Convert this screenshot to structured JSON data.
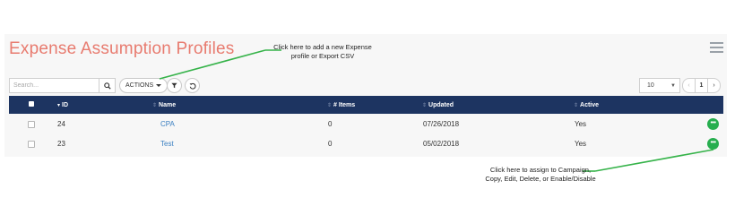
{
  "page": {
    "title": "Expense Assumption Profiles"
  },
  "toolbar": {
    "search_placeholder": "Search...",
    "actions_label": "ACTIONS",
    "page_size": "10",
    "current_page": "1"
  },
  "table": {
    "columns": [
      "ID",
      "Name",
      "# Items",
      "Updated",
      "Active"
    ],
    "rows": [
      {
        "id": "24",
        "name": "CPA",
        "items": "0",
        "updated": "07/26/2018",
        "active": "Yes"
      },
      {
        "id": "23",
        "name": "Test",
        "items": "0",
        "updated": "05/02/2018",
        "active": "Yes"
      }
    ]
  },
  "annotations": {
    "top": "Click here to add a new Expense profile or Export CSV",
    "bottom": "Click here to assign to Campaign, Copy, Edit, Delete, or Enable/Disable"
  },
  "colors": {
    "title": "#e87b6f",
    "header_bg": "#1d3461",
    "action_green": "#27ae4f",
    "callout_line": "#36b34a",
    "link": "#3a7fc1"
  },
  "icons": {
    "menu": "hamburger-icon",
    "search": "search-icon",
    "filter": "filter-icon",
    "refresh": "refresh-icon",
    "row_action": "more-icon"
  }
}
